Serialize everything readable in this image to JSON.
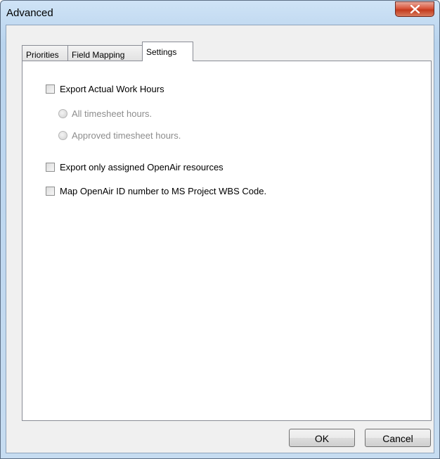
{
  "window": {
    "title": "Advanced"
  },
  "tabs": [
    {
      "label": "Priorities"
    },
    {
      "label": "Field Mapping"
    },
    {
      "label": "Settings",
      "active": true
    }
  ],
  "settings": {
    "export_actual_work_hours": {
      "label": "Export Actual Work Hours",
      "checked": false
    },
    "radio_options": [
      {
        "label": "All timesheet hours.",
        "disabled": true,
        "selected": false
      },
      {
        "label": "Approved timesheet hours.",
        "disabled": true,
        "selected": false
      }
    ],
    "export_assigned_resources": {
      "label": "Export only assigned OpenAir resources",
      "checked": false
    },
    "map_id_wbs": {
      "label": "Map OpenAir ID number to MS Project WBS Code.",
      "checked": false
    }
  },
  "buttons": {
    "ok": "OK",
    "cancel": "Cancel"
  }
}
